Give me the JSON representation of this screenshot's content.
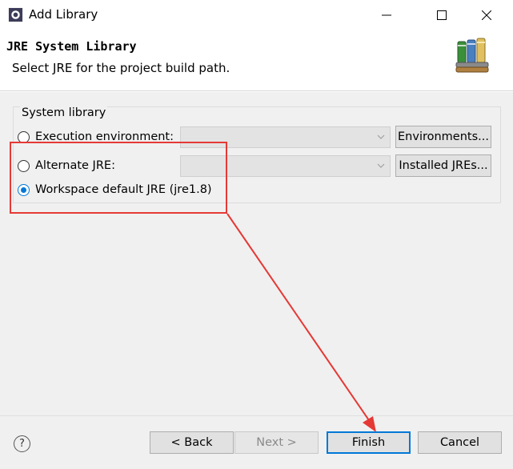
{
  "window": {
    "title": "Add Library",
    "app_icon": "eclipse-icon",
    "controls": {
      "minimize_icon": "minimize-icon",
      "maximize_icon": "maximize-icon",
      "close_icon": "close-icon"
    }
  },
  "header": {
    "title": "JRE System Library",
    "description": "Select JRE for the project build path.",
    "icon": "library-books-icon"
  },
  "system_library": {
    "group_label": "System library",
    "options": [
      {
        "label": "Execution environment:",
        "selected": false,
        "combo_value": "",
        "button": "Environments..."
      },
      {
        "label": "Alternate JRE:",
        "selected": false,
        "combo_value": "",
        "button": "Installed JREs..."
      },
      {
        "label": "Workspace default JRE (jre1.8)",
        "selected": true
      }
    ]
  },
  "footer": {
    "help_icon": "help-icon",
    "back": "< Back",
    "next": "Next >",
    "finish": "Finish",
    "cancel": "Cancel"
  },
  "colors": {
    "accent": "#0078d7",
    "annotation": "#e53935",
    "panel": "#f0f0f0"
  }
}
